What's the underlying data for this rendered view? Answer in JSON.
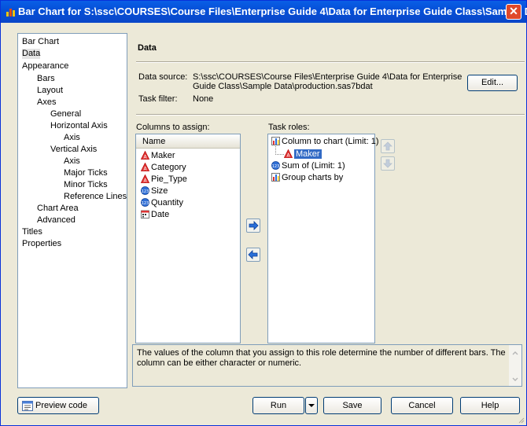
{
  "window": {
    "title": "Bar Chart for S:\\ssc\\COURSES\\Course Files\\Enterprise Guide 4\\Data for Enterprise Guide Class\\Sample Dat...",
    "close": "✕"
  },
  "nav": {
    "items": [
      {
        "label": "Bar Chart"
      },
      {
        "label": "Data"
      },
      {
        "label": "Appearance"
      },
      {
        "label": "Bars"
      },
      {
        "label": "Layout"
      },
      {
        "label": "Axes"
      },
      {
        "label": "General"
      },
      {
        "label": "Horizontal Axis"
      },
      {
        "label": "Axis"
      },
      {
        "label": "Vertical Axis"
      },
      {
        "label": "Axis"
      },
      {
        "label": "Major Ticks"
      },
      {
        "label": "Minor Ticks"
      },
      {
        "label": "Reference Lines"
      },
      {
        "label": "Chart Area"
      },
      {
        "label": "Advanced"
      },
      {
        "label": "Titles"
      },
      {
        "label": "Properties"
      }
    ]
  },
  "data_panel": {
    "title": "Data",
    "data_source_label": "Data source:",
    "data_source_value_1": "S:\\ssc\\COURSES\\Course Files\\Enterprise Guide 4\\Data for Enterprise",
    "data_source_value_2": "Guide Class\\Sample Data\\production.sas7bdat",
    "task_filter_label": "Task filter:",
    "task_filter_value": "None",
    "edit_button": "Edit...",
    "columns_label": "Columns to assign:",
    "columns_header": "Name",
    "columns": [
      {
        "name": "Maker",
        "icon": "character-column-icon"
      },
      {
        "name": "Category",
        "icon": "character-column-icon"
      },
      {
        "name": "Pie_Type",
        "icon": "character-column-icon"
      },
      {
        "name": "Size",
        "icon": "numeric-column-icon"
      },
      {
        "name": "Quantity",
        "icon": "numeric-column-icon"
      },
      {
        "name": "Date",
        "icon": "date-column-icon"
      }
    ],
    "roles_label": "Task roles:",
    "roles": {
      "column_to_chart": "Column to chart  (Limit: 1)",
      "column_to_chart_value": "Maker",
      "sum_of": "Sum of  (Limit: 1)",
      "group_by": "Group charts by"
    },
    "description": "The values of the column that you assign to this role determine the number of different bars. The column can be either character or numeric."
  },
  "footer": {
    "preview": "Preview code",
    "run": "Run",
    "save": "Save",
    "cancel": "Cancel",
    "help": "Help"
  },
  "colors": {
    "selection": "#316ac5",
    "title_bar": "#0a5fe6"
  }
}
